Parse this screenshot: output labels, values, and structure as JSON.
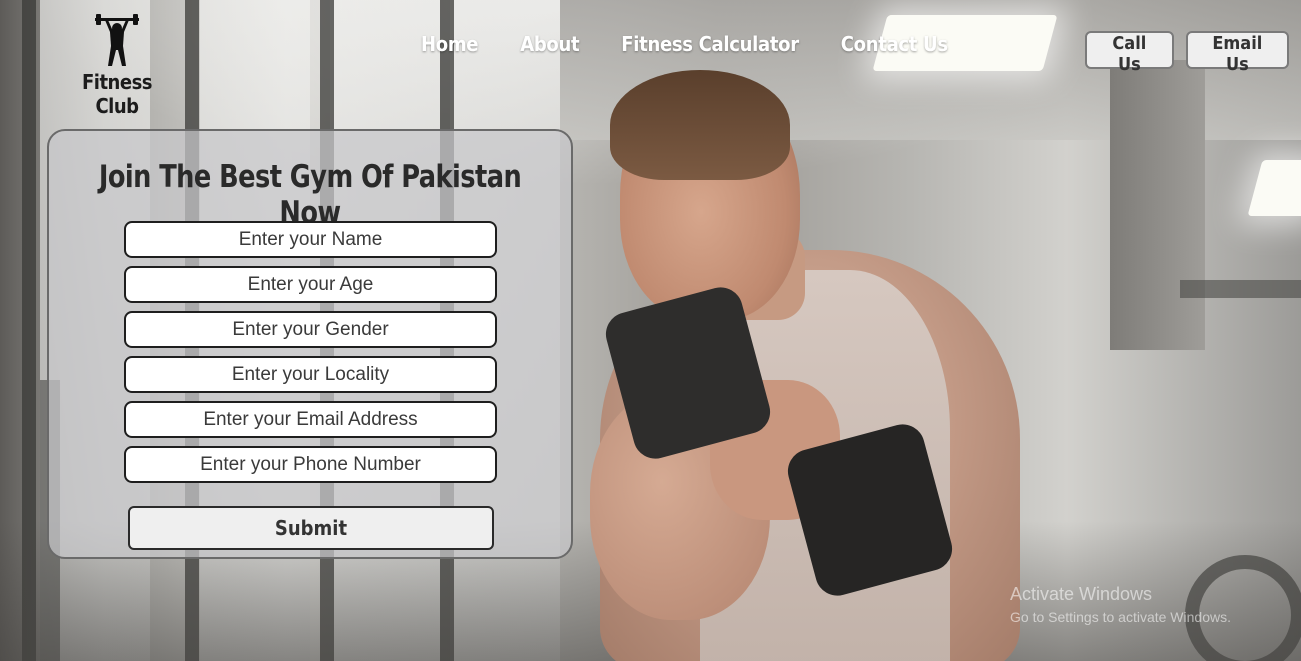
{
  "brand": {
    "name": "Fitness Club",
    "logo_icon": "weightlifter-icon"
  },
  "nav": {
    "items": [
      {
        "label": "Home"
      },
      {
        "label": "About"
      },
      {
        "label": "Fitness Calculator"
      },
      {
        "label": "Contact Us"
      }
    ]
  },
  "contact": {
    "call_label": "Call Us",
    "email_label": "Email Us"
  },
  "form": {
    "heading": "Join The Best Gym Of Pakistan Now",
    "fields": [
      {
        "placeholder": "Enter your Name",
        "value": ""
      },
      {
        "placeholder": "Enter your Age",
        "value": ""
      },
      {
        "placeholder": "Enter your Gender",
        "value": ""
      },
      {
        "placeholder": "Enter your Locality",
        "value": ""
      },
      {
        "placeholder": "Enter your Email Address",
        "value": ""
      },
      {
        "placeholder": "Enter your Phone Number",
        "value": ""
      }
    ],
    "submit_label": "Submit"
  },
  "watermark": {
    "line1": "Activate Windows",
    "line2": "Go to Settings to activate Windows."
  },
  "colors": {
    "nav_text": "#ffffff",
    "panel_bg": "#c8c8ca",
    "panel_border": "#6a6a6a",
    "button_bg": "#efefef"
  }
}
